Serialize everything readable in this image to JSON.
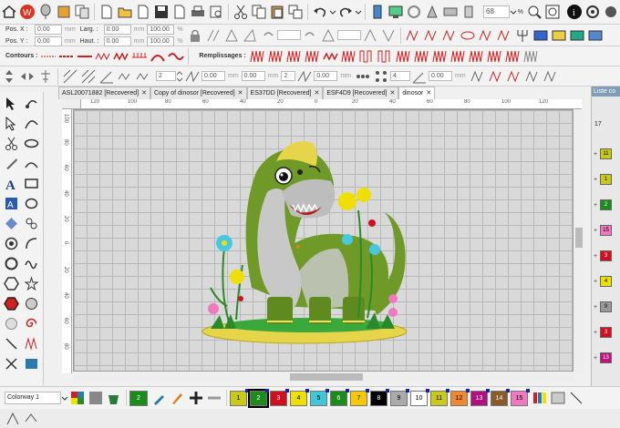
{
  "toolbar": {
    "zoom_value": "68",
    "zoom_unit": "%"
  },
  "props": {
    "pos_x_label": "Pos. X :",
    "pos_y_label": "Pos. Y :",
    "pos_x": "0.00",
    "pos_y": "0.00",
    "width_label": "Larg. :",
    "height_label": "Haut. :",
    "width": "0.00",
    "height": "0.00",
    "scale_w": "100.00",
    "scale_h": "100.00",
    "unit_mm": "mm",
    "unit_pct": "%"
  },
  "styles": {
    "contours_label": "Contours :",
    "remplissages_label": "Remplissages :"
  },
  "params": {
    "v1": "2",
    "v2": "0.00",
    "v3": "0.00",
    "v4": "2",
    "v5": "0.00",
    "v6": "4",
    "v7": "0.00",
    "unit_mm": "mm"
  },
  "tabs": [
    {
      "label": "ASL20071882 [Recovered]"
    },
    {
      "label": "Copy of dinosor [Recovered]"
    },
    {
      "label": "ES37DD [Recovered]"
    },
    {
      "label": "ESF4D9 [Recovered]"
    },
    {
      "label": "dinosor"
    }
  ],
  "ruler": {
    "h": [
      "120",
      "100",
      "80",
      "60",
      "40",
      "20",
      "0",
      "20",
      "40",
      "60",
      "80",
      "100",
      "120"
    ],
    "v": [
      "100",
      "80",
      "60",
      "40",
      "20",
      "0",
      "20",
      "40",
      "60",
      "80"
    ]
  },
  "right_panel": {
    "title": "Liste co",
    "count": "17",
    "items": [
      {
        "num": "11",
        "color": "#c9c91a"
      },
      {
        "num": "1",
        "color": "#c9c91a"
      },
      {
        "num": "2",
        "color": "#1b8b1b"
      },
      {
        "num": "15",
        "color": "#f078c0"
      },
      {
        "num": "3",
        "color": "#d01020"
      },
      {
        "num": "4",
        "color": "#f0e000"
      },
      {
        "num": "9",
        "color": "#999999"
      },
      {
        "num": "3",
        "color": "#d01020"
      },
      {
        "num": "13",
        "color": "#c01080"
      }
    ]
  },
  "bottom": {
    "colorway": "Colorway 1",
    "current_color": "2",
    "palette": [
      {
        "num": "1",
        "color": "#c9c91a",
        "text": "#000"
      },
      {
        "num": "2",
        "color": "#1b8b1b",
        "text": "#fff"
      },
      {
        "num": "3",
        "color": "#d01020",
        "text": "#fff"
      },
      {
        "num": "4",
        "color": "#f0e000",
        "text": "#000"
      },
      {
        "num": "5",
        "color": "#40c8d8",
        "text": "#000"
      },
      {
        "num": "6",
        "color": "#1b8b1b",
        "text": "#fff"
      },
      {
        "num": "7",
        "color": "#f8c800",
        "text": "#000"
      },
      {
        "num": "8",
        "color": "#000000",
        "text": "#fff"
      },
      {
        "num": "9",
        "color": "#aaaaaa",
        "text": "#000"
      },
      {
        "num": "10",
        "color": "#ffffff",
        "text": "#000"
      },
      {
        "num": "11",
        "color": "#c9c91a",
        "text": "#000"
      },
      {
        "num": "12",
        "color": "#f08830",
        "text": "#000"
      },
      {
        "num": "13",
        "color": "#b01080",
        "text": "#fff"
      },
      {
        "num": "14",
        "color": "#8b5a2b",
        "text": "#fff"
      },
      {
        "num": "15",
        "color": "#f078c0",
        "text": "#000"
      }
    ]
  }
}
